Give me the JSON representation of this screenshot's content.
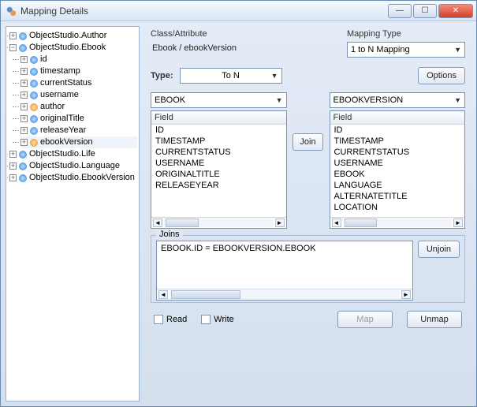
{
  "window": {
    "title": "Mapping Details"
  },
  "tree": {
    "root": [
      {
        "label": "ObjectStudio.Author",
        "icon": "blue",
        "expandable": true,
        "expanded": false
      },
      {
        "label": "ObjectStudio.Ebook",
        "icon": "blue",
        "expandable": true,
        "expanded": true,
        "children": [
          {
            "label": "id",
            "icon": "blue",
            "expandable": true
          },
          {
            "label": "timestamp",
            "icon": "blue",
            "expandable": true
          },
          {
            "label": "currentStatus",
            "icon": "blue",
            "expandable": true
          },
          {
            "label": "username",
            "icon": "blue",
            "expandable": true
          },
          {
            "label": "author",
            "icon": "orange",
            "expandable": true
          },
          {
            "label": "originalTitle",
            "icon": "blue",
            "expandable": true
          },
          {
            "label": "releaseYear",
            "icon": "blue",
            "expandable": true
          },
          {
            "label": "ebookVersion",
            "icon": "orange",
            "expandable": true,
            "selected": true
          }
        ]
      },
      {
        "label": "ObjectStudio.Life",
        "icon": "blue",
        "expandable": true,
        "expanded": false
      },
      {
        "label": "ObjectStudio.Language",
        "icon": "blue",
        "expandable": true,
        "expanded": false
      },
      {
        "label": "ObjectStudio.EbookVersion",
        "icon": "blue",
        "expandable": true,
        "expanded": false
      }
    ]
  },
  "header": {
    "classAttrLabel": "Class/Attribute",
    "classAttrValue": "Ebook / ebookVersion",
    "mappingTypeLabel": "Mapping Type",
    "mappingTypeValue": "1 to N Mapping"
  },
  "typeRow": {
    "label": "Type:",
    "value": "To N",
    "optionsBtn": "Options"
  },
  "leftTable": {
    "combo": "EBOOK",
    "header": "Field",
    "items": [
      "ID",
      "TIMESTAMP",
      "CURRENTSTATUS",
      "USERNAME",
      "ORIGINALTITLE",
      "RELEASEYEAR"
    ]
  },
  "rightTable": {
    "combo": "EBOOKVERSION",
    "header": "Field",
    "items": [
      "ID",
      "TIMESTAMP",
      "CURRENTSTATUS",
      "USERNAME",
      "EBOOK",
      "LANGUAGE",
      "ALTERNATETITLE",
      "LOCATION"
    ]
  },
  "joinBtn": "Join",
  "joins": {
    "caption": "Joins",
    "text": "EBOOK.ID = EBOOKVERSION.EBOOK",
    "unjoinBtn": "Unjoin"
  },
  "bottom": {
    "read": "Read",
    "write": "Write",
    "map": "Map",
    "unmap": "Unmap"
  }
}
